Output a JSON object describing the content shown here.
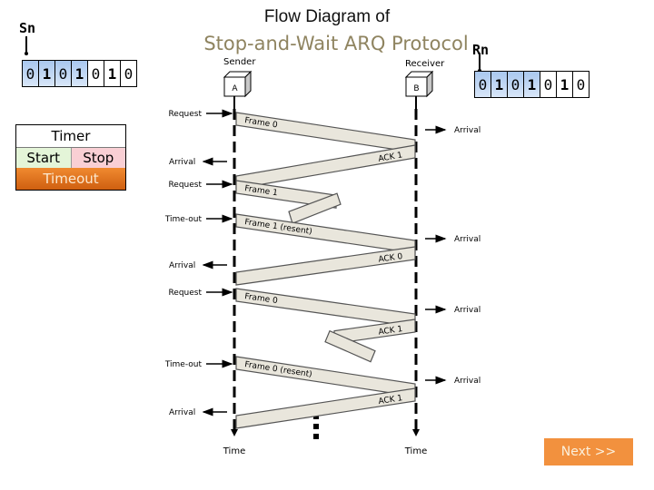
{
  "title": {
    "line1": "Flow Diagram of",
    "line2": "Stop-and-Wait ARQ Protocol"
  },
  "sender_window": {
    "pointer_label": "Sn",
    "bits": [
      "0",
      "1",
      "0",
      "1",
      "0",
      "1",
      "0"
    ],
    "bold": [
      false,
      true,
      false,
      true,
      false,
      true,
      false
    ],
    "highlighted": [
      true,
      true,
      true,
      true,
      false,
      false,
      false
    ]
  },
  "receiver_window": {
    "pointer_label": "Rn",
    "bits": [
      "0",
      "1",
      "0",
      "1",
      "0",
      "1",
      "0"
    ],
    "bold": [
      false,
      true,
      false,
      true,
      false,
      true,
      false
    ],
    "highlighted": [
      true,
      true,
      true,
      true,
      false,
      false,
      false
    ]
  },
  "timer_legend": {
    "title": "Timer",
    "start": "Start",
    "stop": "Stop",
    "timeout": "Timeout",
    "colors": {
      "start": "#e4f5d8",
      "stop": "#f9cfd4",
      "timeout": "#e07020"
    }
  },
  "nodes": {
    "sender": {
      "role": "Sender",
      "name": "A"
    },
    "receiver": {
      "role": "Receiver",
      "name": "B"
    },
    "time_label": "Time"
  },
  "sender_events": [
    "Request",
    "Arrival",
    "Request",
    "Time-out",
    "Arrival",
    "Request",
    "Time-out",
    "Arrival"
  ],
  "receiver_events": [
    "Arrival",
    "Arrival",
    "Arrival",
    "Arrival"
  ],
  "packets": [
    {
      "label": "Frame 0",
      "direction": "A-to-B",
      "lost": false
    },
    {
      "label": "ACK 1",
      "direction": "B-to-A",
      "lost": false
    },
    {
      "label": "Frame 1",
      "direction": "A-to-B",
      "lost": true
    },
    {
      "label": "Frame 1 (resent)",
      "direction": "A-to-B",
      "lost": false
    },
    {
      "label": "ACK 0",
      "direction": "B-to-A",
      "lost": false
    },
    {
      "label": "Frame 0",
      "direction": "A-to-B",
      "lost": false
    },
    {
      "label": "ACK 1",
      "direction": "B-to-A",
      "lost": true
    },
    {
      "label": "Frame 0 (resent)",
      "direction": "A-to-B",
      "lost": false
    },
    {
      "label": "ACK 1",
      "direction": "B-to-A",
      "lost": false
    }
  ],
  "next_button": {
    "label": "Next >>",
    "color": "#f2913e"
  }
}
